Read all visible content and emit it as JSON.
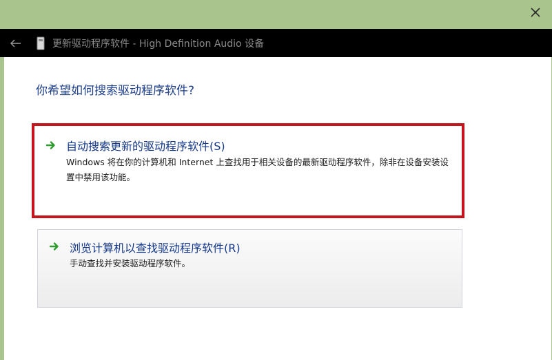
{
  "window": {
    "title": "更新驱动程序软件 - High Definition Audio 设备"
  },
  "page": {
    "question": "你希望如何搜索驱动程序软件?"
  },
  "options": [
    {
      "title": "自动搜索更新的驱动程序软件(S)",
      "description": "Windows 将在你的计算机和 Internet 上查找用于相关设备的最新驱动程序软件，除非在设备安装设置中禁用该功能。"
    },
    {
      "title": "浏览计算机以查找驱动程序软件(R)",
      "description": "手动查找并安装驱动程序软件。"
    }
  ],
  "icons": {
    "close": "close-icon",
    "back": "back-arrow-icon",
    "device": "device-icon",
    "option_arrow": "green-arrow-icon"
  },
  "colors": {
    "highlight_border": "#c3161c",
    "arrow_green": "#2f9b2f",
    "title_blue": "#13378a",
    "window_frame": "#a9c48d"
  }
}
